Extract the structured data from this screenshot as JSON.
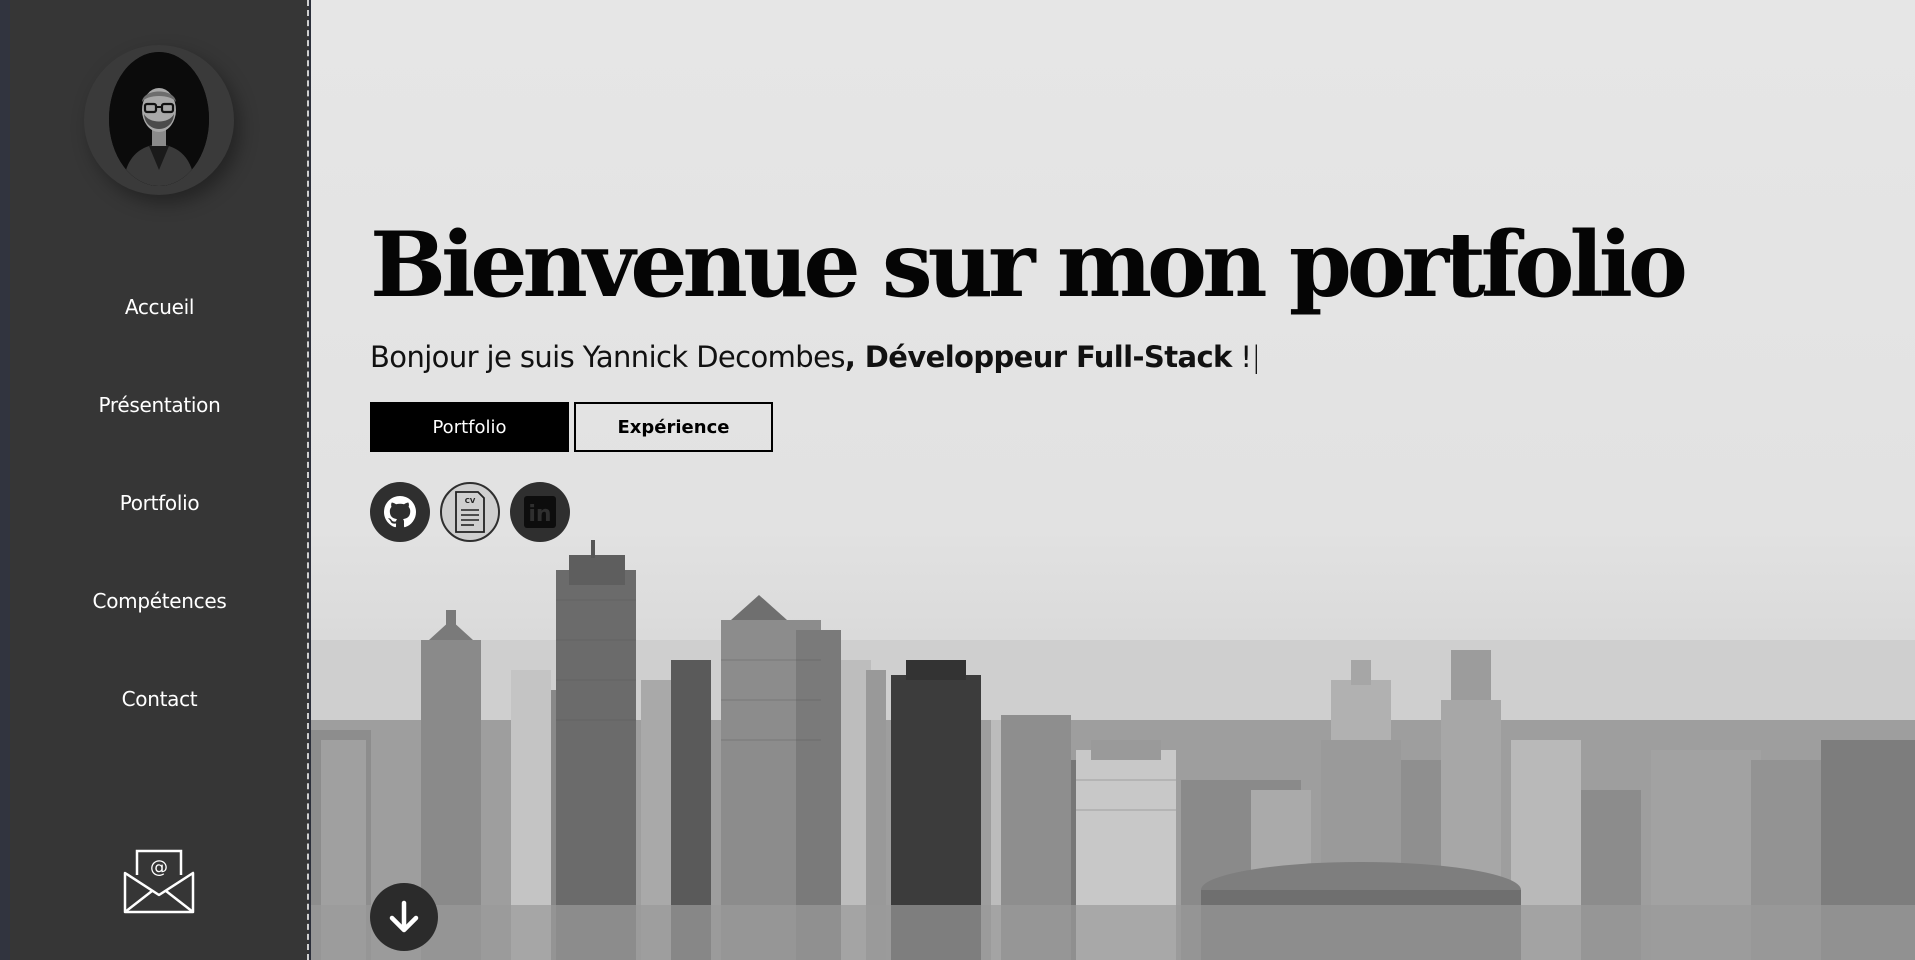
{
  "sidebar": {
    "avatar_icon": "user-portrait",
    "nav": [
      {
        "label": "Accueil"
      },
      {
        "label": "Présentation"
      },
      {
        "label": "Portfolio"
      },
      {
        "label": "Compétences"
      },
      {
        "label": "Contact"
      }
    ],
    "mail_icon": "envelope-at-icon",
    "mail_label": "@"
  },
  "hero": {
    "title": "Bienvenue sur mon portfolio",
    "subtitle_prefix": "Bonjour je suis Yannick Decombes",
    "subtitle_strong": ", Développeur Full-Stack",
    "subtitle_suffix": " !",
    "cursor": "|",
    "buttons": {
      "portfolio": "Portfolio",
      "experience": "Expérience"
    },
    "social": [
      {
        "icon": "github-icon"
      },
      {
        "icon": "cv-document-icon",
        "label": "CV"
      },
      {
        "icon": "linkedin-icon",
        "label": "in"
      }
    ],
    "scroll_icon": "arrow-down-icon"
  },
  "colors": {
    "sidebar_bg": "#363636",
    "hero_text": "#050505",
    "button_dark": "#000000",
    "icon_bg": "#2f2f2f"
  }
}
